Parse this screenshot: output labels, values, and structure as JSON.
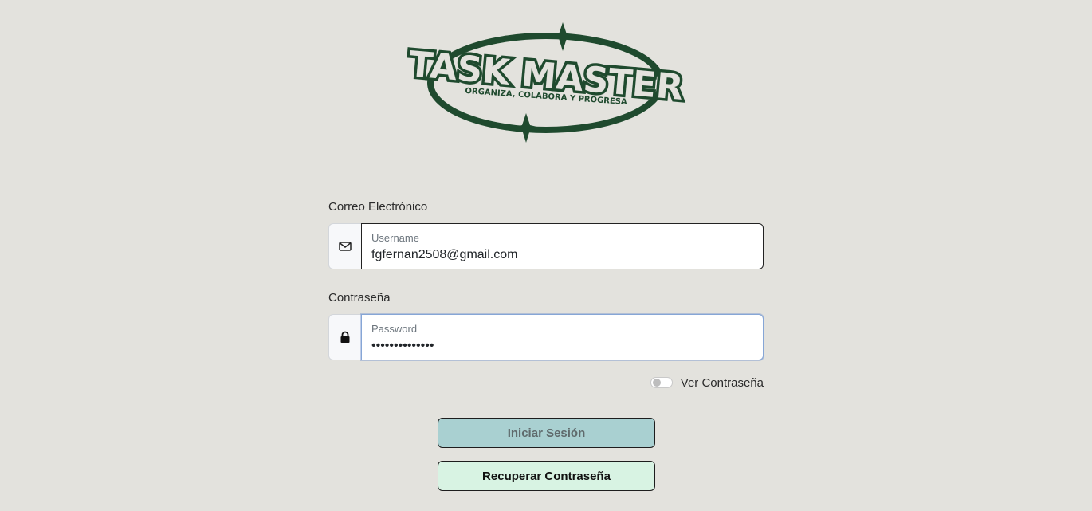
{
  "brand": {
    "logo_title": "TASK MASTER",
    "logo_tagline": "ORGANIZA, COLABORA Y PROGRESA",
    "logo_color": "#1f4a2e"
  },
  "form": {
    "email_label": "Correo Electrónico",
    "email_placeholder": "Username",
    "email_value": "fgfernan2508@gmail.com",
    "password_label": "Contraseña",
    "password_placeholder": "Password",
    "password_value": "••••••••••••••",
    "show_password_label": "Ver Contraseña",
    "show_password_enabled": false
  },
  "actions": {
    "login_label": "Iniciar Sesión",
    "recover_label": "Recuperar Contraseña"
  },
  "icons": {
    "email": "envelope-icon",
    "password": "lock-icon"
  },
  "colors": {
    "background": "#e3e2dd",
    "login_button": "#a9d0d1",
    "recover_button": "#d8f3e3"
  }
}
